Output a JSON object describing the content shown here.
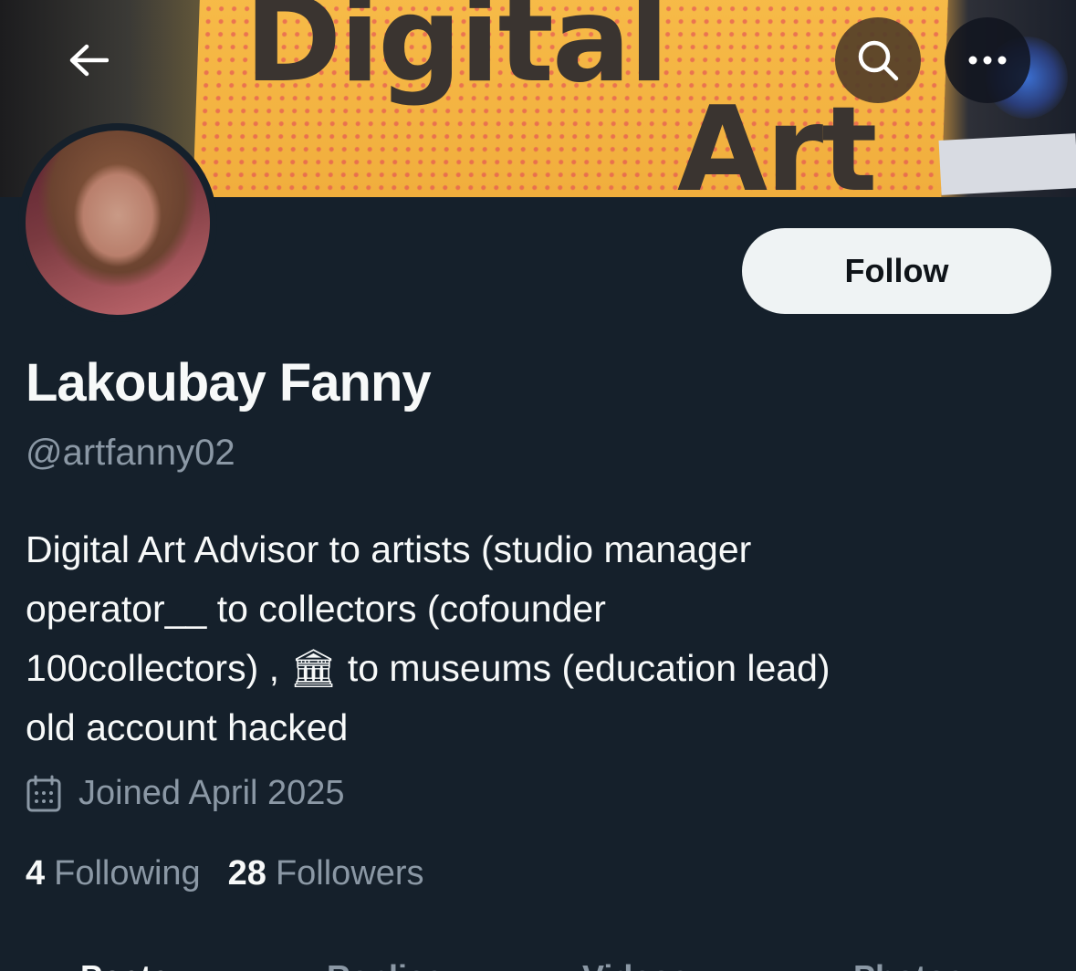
{
  "banner": {
    "line1": "Digital",
    "line2": "Art"
  },
  "profile": {
    "name": "Lakoubay Fanny",
    "handle": "@artfanny02",
    "follow_label": "Follow",
    "bio_lines": [
      "Digital Art Advisor to artists (studio manager",
      "operator__ to collectors (cofounder",
      "100collectors) , 🏛 to museums (education lead)",
      "old account hacked"
    ],
    "joined": "Joined April 2025",
    "following_count": "4",
    "following_label": "Following",
    "followers_count": "28",
    "followers_label": "Followers"
  },
  "tabs": [
    "Posts",
    "Replies",
    "Videos",
    "Photos"
  ],
  "icons": {
    "back": "arrow-left-icon",
    "search": "search-icon",
    "more": "more-dots-icon",
    "calendar": "calendar-icon"
  },
  "colors": {
    "background": "#15202b",
    "follow_button": "#eff3f4",
    "secondary_text": "#8b98a5"
  }
}
